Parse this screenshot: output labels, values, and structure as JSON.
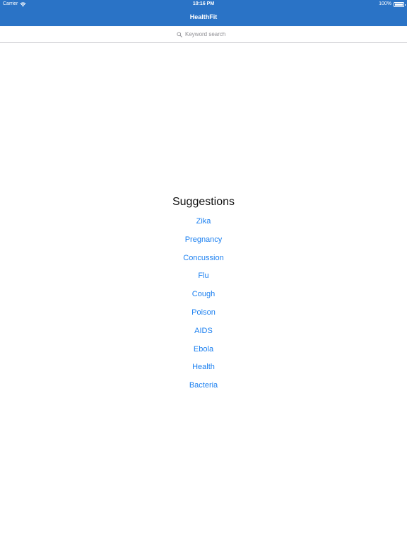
{
  "status_bar": {
    "carrier": "Carrier",
    "time": "10:16 PM",
    "battery": "100%",
    "battery_level": 1.0,
    "wifi_icon": "wifi-icon",
    "battery_icon": "battery-icon"
  },
  "nav": {
    "title": "HealthFit"
  },
  "search": {
    "placeholder": "Keyword search",
    "value": "",
    "icon": "search-icon"
  },
  "suggestions": {
    "title": "Suggestions",
    "items": [
      {
        "label": "Zika"
      },
      {
        "label": "Pregnancy"
      },
      {
        "label": "Concussion"
      },
      {
        "label": "Flu"
      },
      {
        "label": "Cough"
      },
      {
        "label": "Poison"
      },
      {
        "label": "AIDS"
      },
      {
        "label": "Ebola"
      },
      {
        "label": "Health"
      },
      {
        "label": "Bacteria"
      }
    ]
  },
  "colors": {
    "bar": "#2a73c6",
    "link": "#1a7ff0",
    "placeholder": "#8e8e93"
  }
}
